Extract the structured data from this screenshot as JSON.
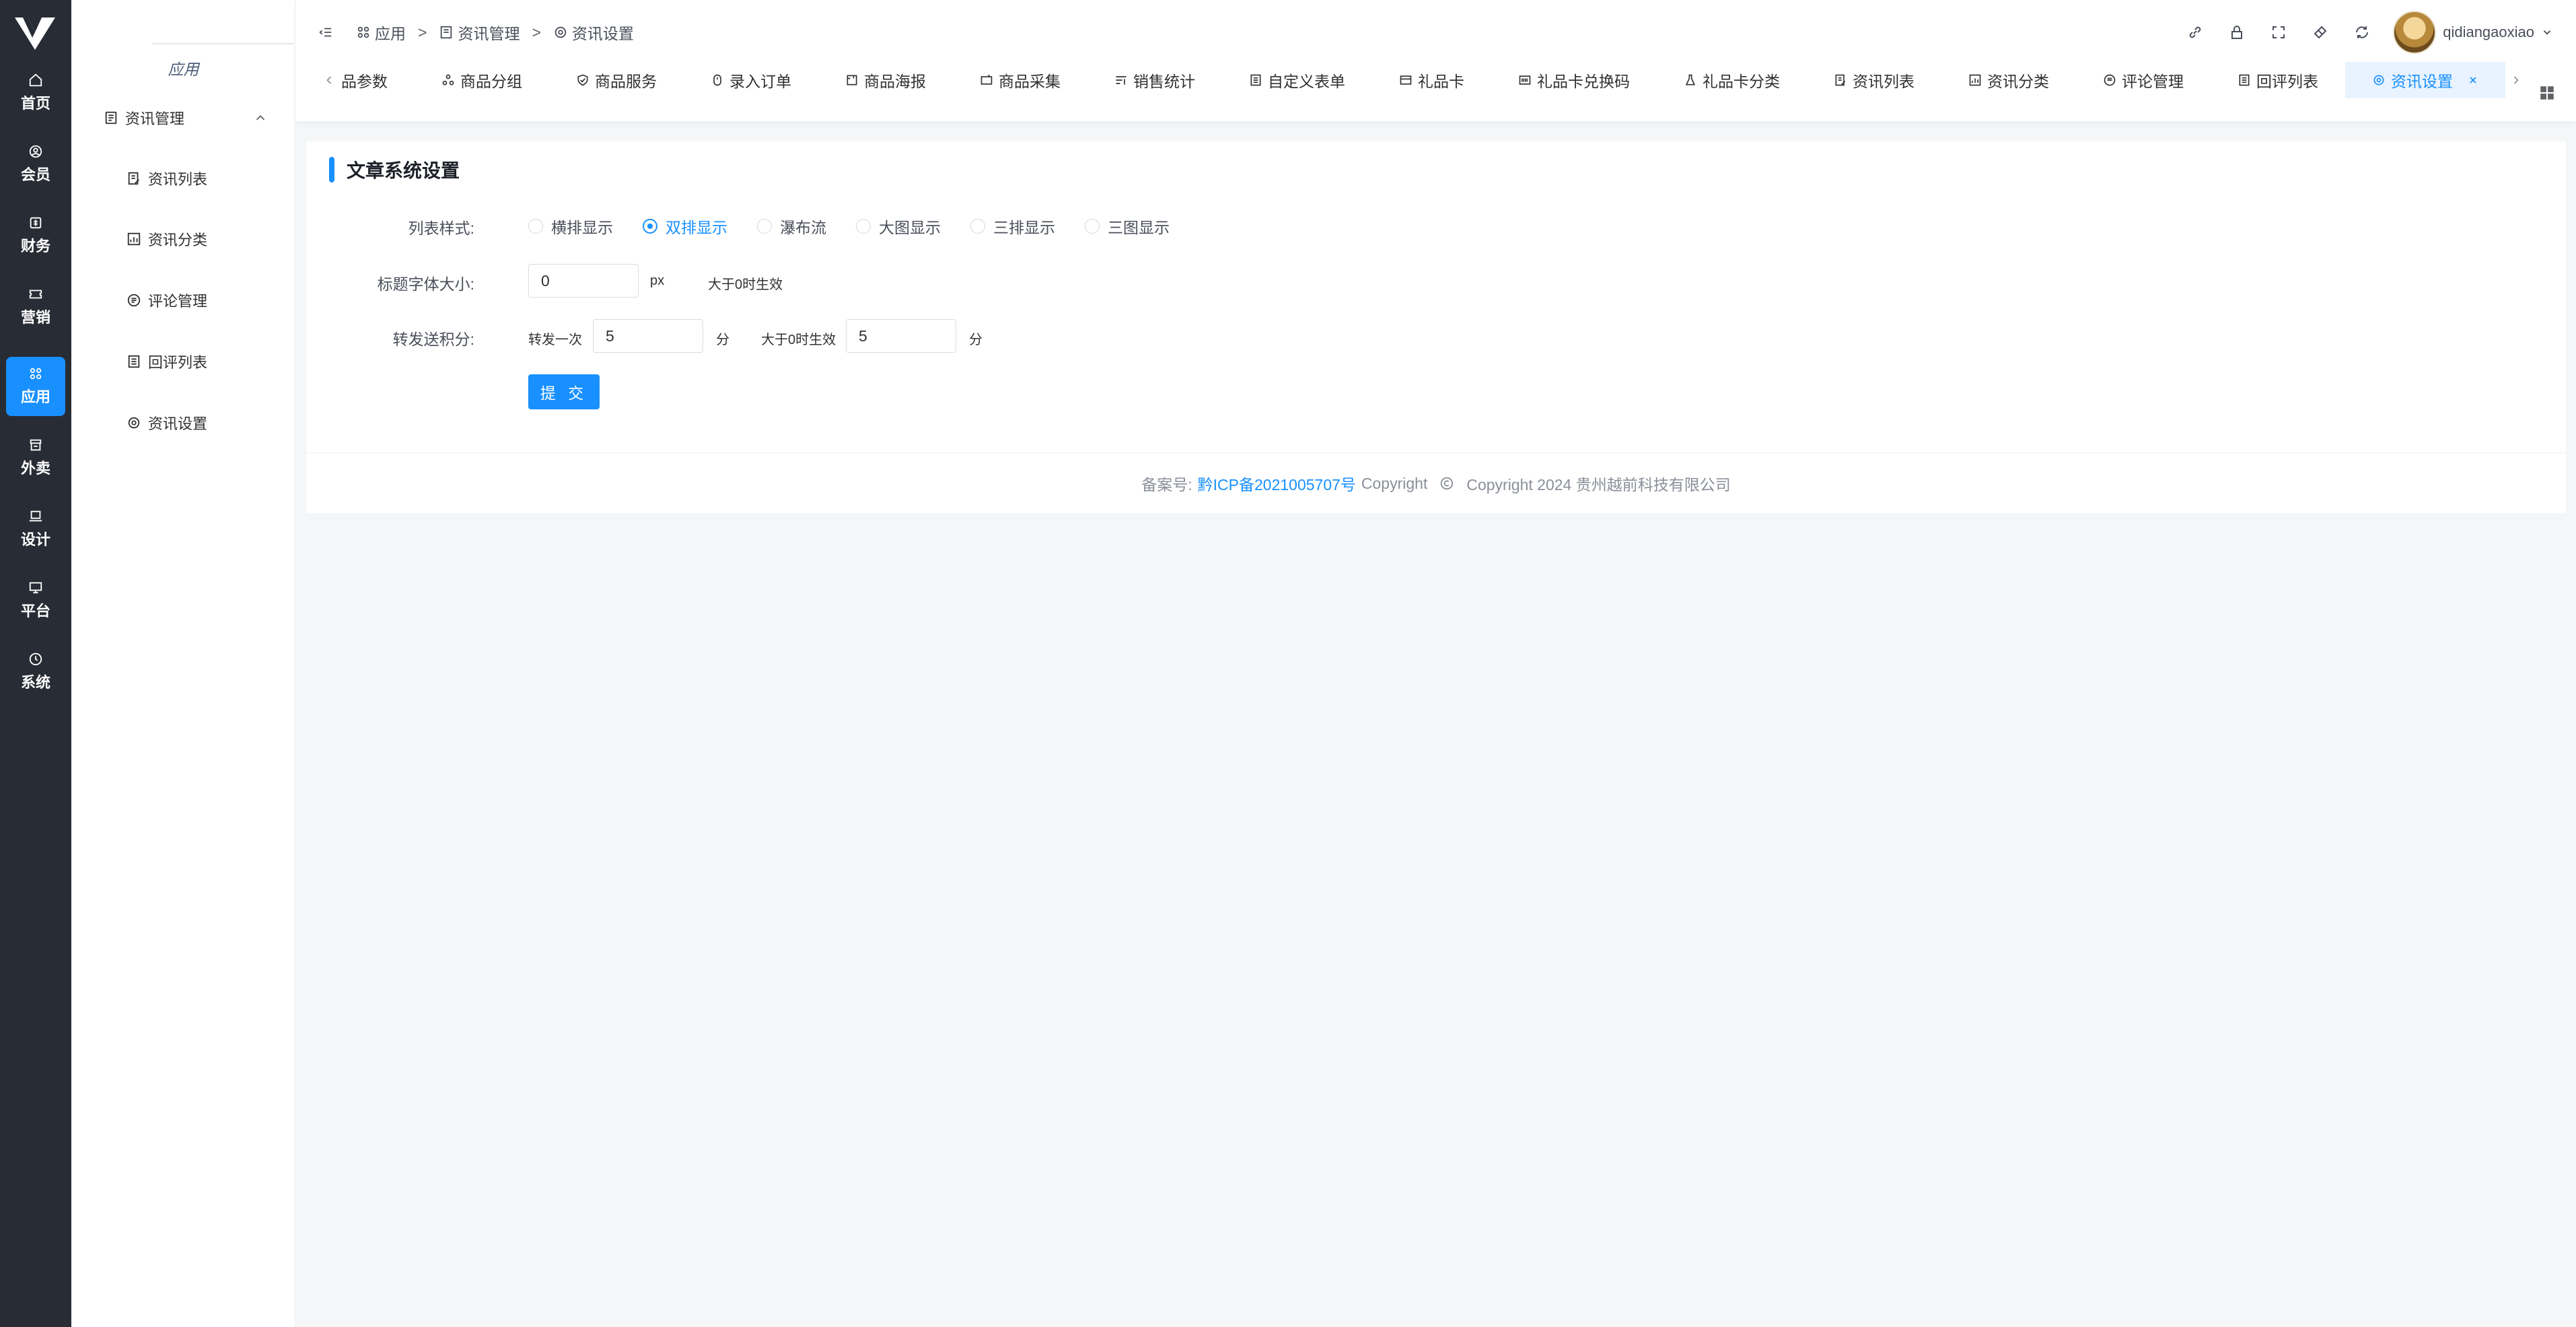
{
  "rail": {
    "items": [
      {
        "label": "首页",
        "icon": "home-icon"
      },
      {
        "label": "会员",
        "icon": "user-circle-icon"
      },
      {
        "label": "财务",
        "icon": "finance-icon"
      },
      {
        "label": "营销",
        "icon": "ticket-icon"
      },
      {
        "label": "应用",
        "icon": "apps-icon",
        "active": true
      },
      {
        "label": "外卖",
        "icon": "store-icon"
      },
      {
        "label": "设计",
        "icon": "laptop-icon"
      },
      {
        "label": "平台",
        "icon": "monitor-icon"
      },
      {
        "label": "系统",
        "icon": "clock-icon"
      }
    ]
  },
  "subnav": {
    "title": "应用",
    "group_label": "资讯管理",
    "items": [
      "资讯列表",
      "资讯分类",
      "评论管理",
      "回评列表",
      "资讯设置"
    ]
  },
  "breadcrumb": {
    "items": [
      "应用",
      "资讯管理",
      "资讯设置"
    ],
    "separator": ">"
  },
  "user": {
    "name": "qidiangaoxiao"
  },
  "tabs": [
    {
      "label": "品参数",
      "icon": ""
    },
    {
      "label": "商品分组",
      "icon": "group-icon"
    },
    {
      "label": "商品服务",
      "icon": "shield-icon"
    },
    {
      "label": "录入订单",
      "icon": "mouse-icon"
    },
    {
      "label": "商品海报",
      "icon": "poster-icon"
    },
    {
      "label": "商品采集",
      "icon": "collect-icon"
    },
    {
      "label": "销售统计",
      "icon": "filter-list-icon"
    },
    {
      "label": "自定义表单",
      "icon": "form-icon"
    },
    {
      "label": "礼品卡",
      "icon": "card-icon"
    },
    {
      "label": "礼品卡兑换码",
      "icon": "barcode-icon"
    },
    {
      "label": "礼品卡分类",
      "icon": "flask-icon"
    },
    {
      "label": "资讯列表",
      "icon": "doc-edit-icon"
    },
    {
      "label": "资讯分类",
      "icon": "chart-icon"
    },
    {
      "label": "评论管理",
      "icon": "comment-icon"
    },
    {
      "label": "回评列表",
      "icon": "list-doc-icon"
    },
    {
      "label": "资讯设置",
      "icon": "gear-icon",
      "active": true
    }
  ],
  "card": {
    "title": "文章系统设置",
    "list_style": {
      "label": "列表样式:",
      "options": [
        "横排显示",
        "双排显示",
        "瀑布流",
        "大图显示",
        "三排显示",
        "三图显示"
      ],
      "selected": "双排显示"
    },
    "title_font": {
      "label": "标题字体大小:",
      "value": "0",
      "unit": "px",
      "hint": "大于0时生效"
    },
    "share_points": {
      "label": "转发送积分:",
      "prefix": "转发一次",
      "value": "5",
      "unit": "分",
      "mid_label": "大于0时生效",
      "value2": "5",
      "unit2": "分"
    },
    "submit_label": "提 交"
  },
  "footer": {
    "prefix": "备案号:",
    "icp": "黔ICP备2021005707号",
    "copyright_word": "Copyright",
    "copyright_text": "Copyright 2024 贵州越前科技有限公司"
  },
  "colors": {
    "primary": "#1890ff",
    "rail_bg": "#282c34",
    "page_bg": "#f5f6f8"
  }
}
